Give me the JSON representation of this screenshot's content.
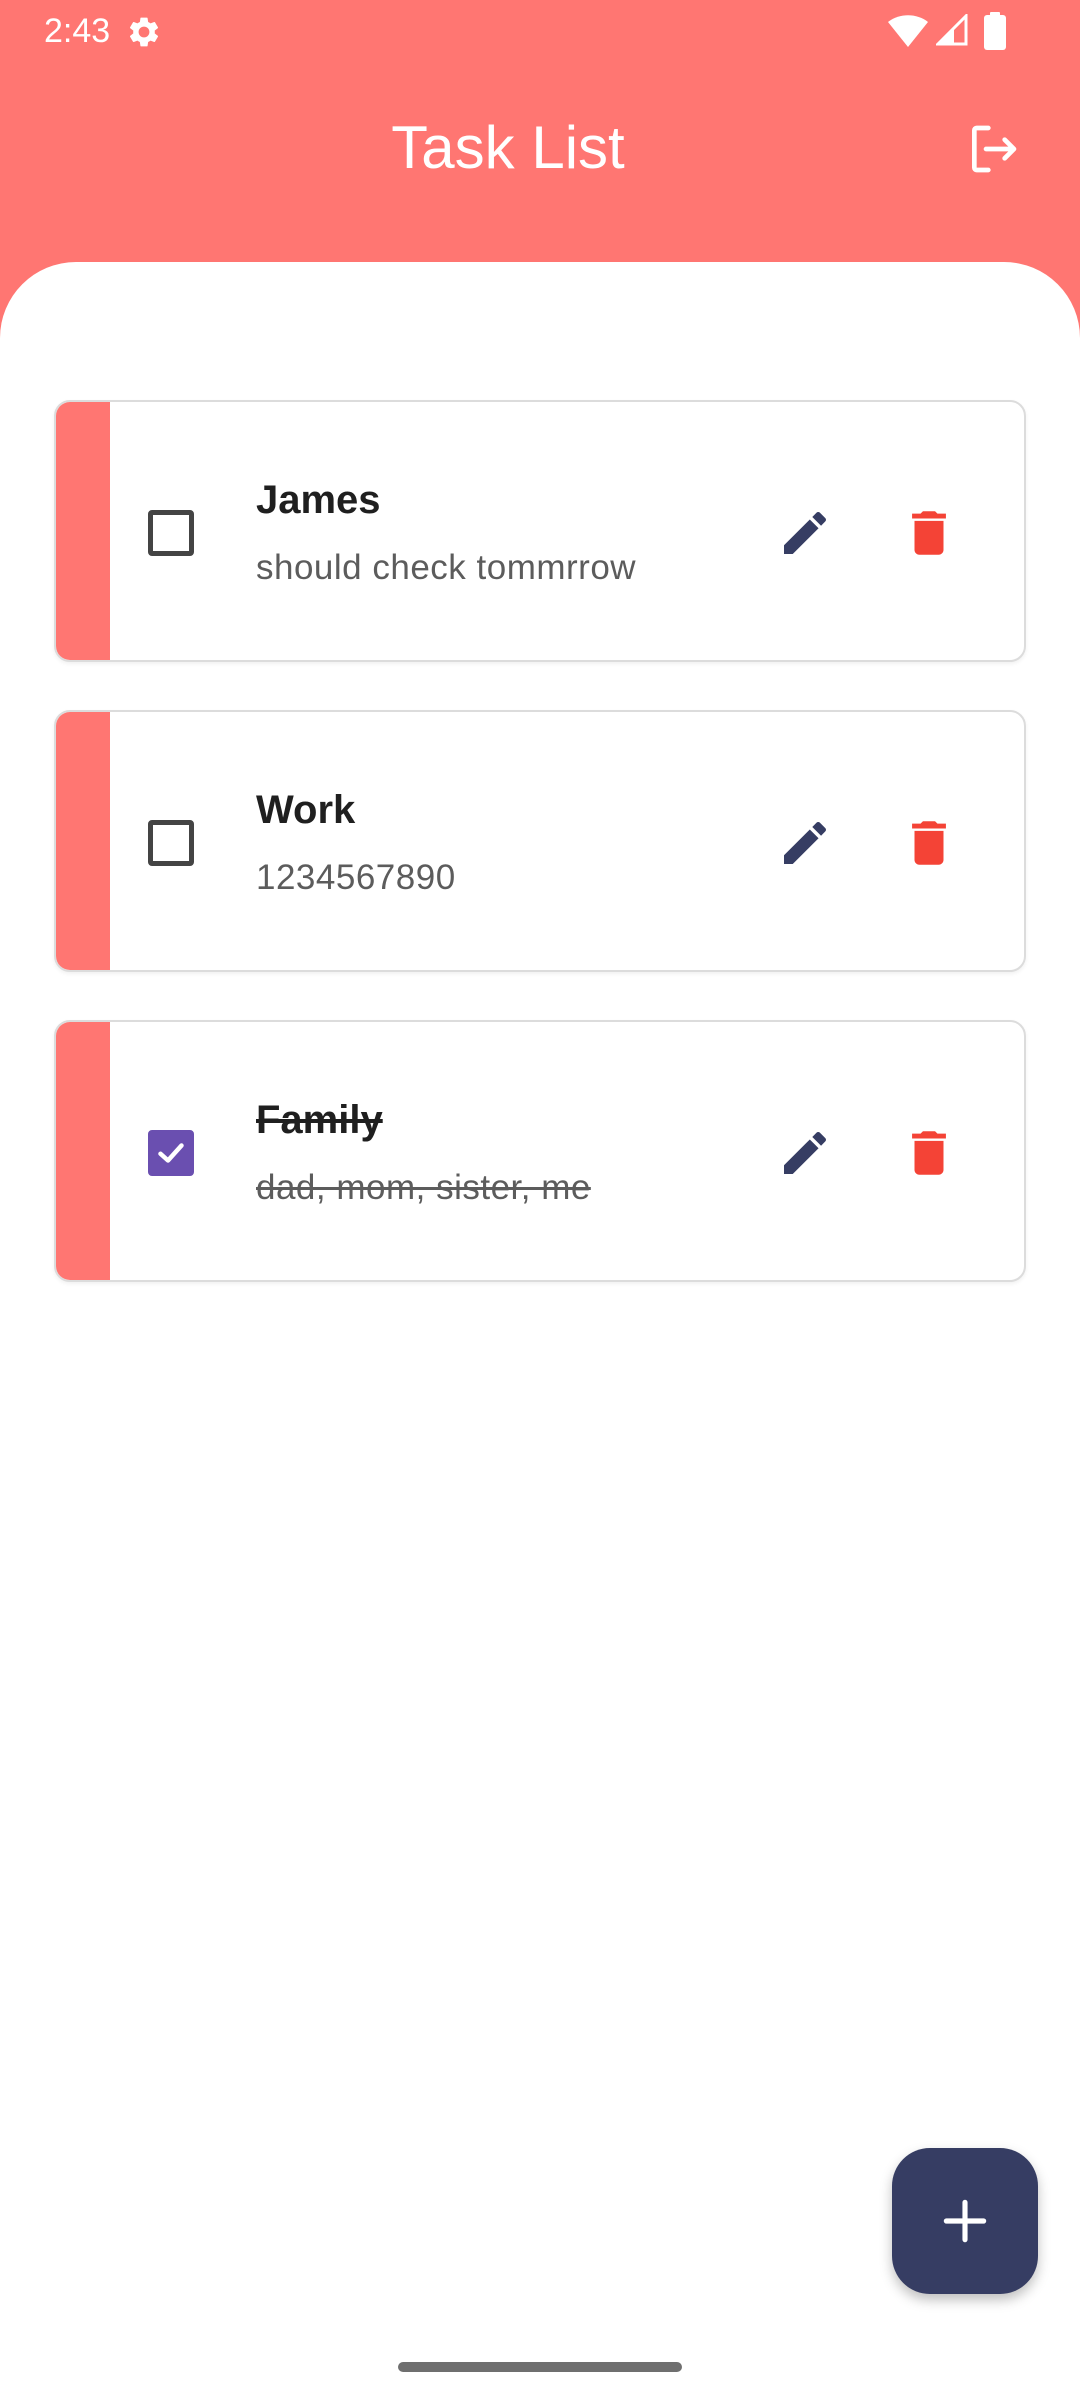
{
  "status_bar": {
    "time": "2:43",
    "icons": [
      "gear-icon",
      "wifi-icon",
      "signal-icon",
      "battery-icon"
    ]
  },
  "header": {
    "title": "Task List",
    "logout_icon": "logout-icon"
  },
  "tasks": [
    {
      "title": "James",
      "description": "should check tommrrow",
      "checked": false
    },
    {
      "title": "Work",
      "description": "1234567890",
      "checked": false
    },
    {
      "title": "Family",
      "description": "dad, mom, sister, me",
      "checked": true
    }
  ],
  "fab": {
    "icon": "plus-icon"
  },
  "colors": {
    "header": "#FF7672",
    "accent_strip": "#FF7672",
    "checkbox_checked": "#6A4FB0",
    "edit_icon": "#363D63",
    "delete_icon": "#F44336",
    "fab_background": "#363D63"
  }
}
